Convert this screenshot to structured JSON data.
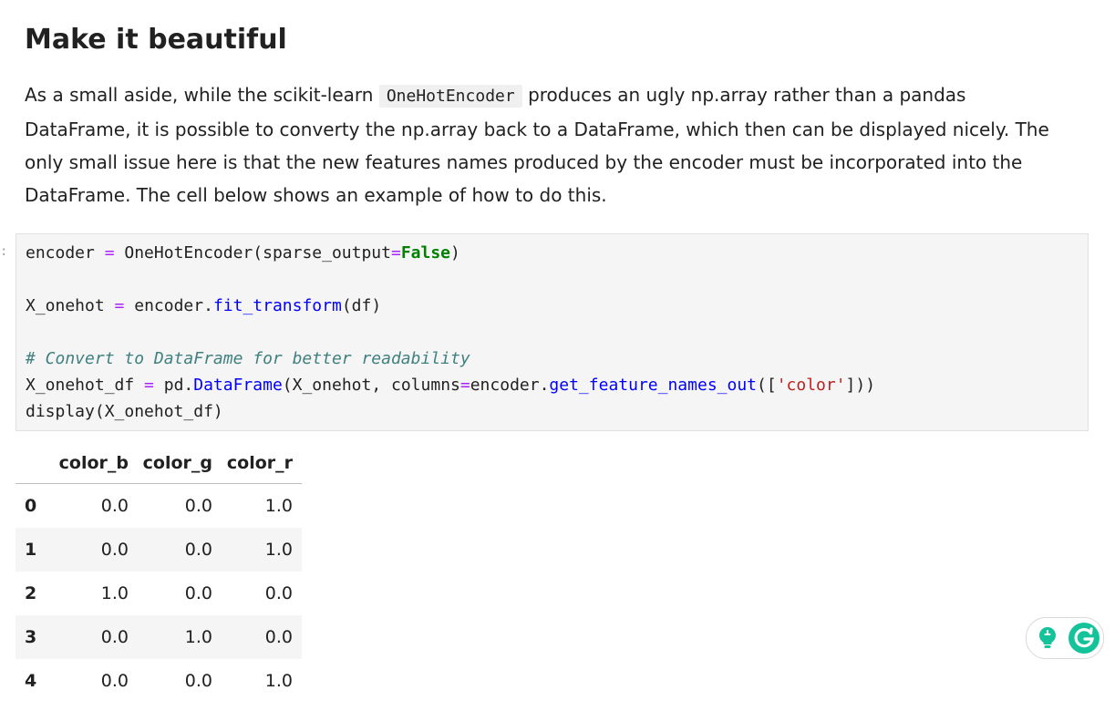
{
  "heading": "Make it beautiful",
  "paragraph": {
    "before_code": "As a small aside, while the scikit-learn ",
    "inline_code": "OneHotEncoder",
    "after_code": " produces an ugly np.array rather than a pandas DataFrame, it is possible to converty the np.array back to a DataFrame, which then can be displayed nicely. The only small issue here is that the new features names produced by the encoder must be incorporated into the DataFrame. The cell below shows an example of how to do this."
  },
  "cell_prompt": ":",
  "code": {
    "line1": {
      "a": "encoder ",
      "op": "=",
      "b": " OneHotEncoder(sparse_output",
      "op2": "=",
      "kw": "False",
      "c": ")"
    },
    "line2": {
      "a": "X_onehot ",
      "op": "=",
      "b": " encoder.",
      "fn": "fit_transform",
      "c": "(df)"
    },
    "line3": {
      "comment": "# Convert to DataFrame for better readability"
    },
    "line4": {
      "a": "X_onehot_df ",
      "op": "=",
      "b": " pd.",
      "fn": "DataFrame",
      "c": "(X_onehot, columns",
      "op2": "=",
      "d": "encoder.",
      "fn2": "get_feature_names_out",
      "e": "([",
      "str": "'color'",
      "f": "]))"
    },
    "line5": {
      "a": "display(X_onehot_df)"
    }
  },
  "colors": {
    "operator": "#aa22ff",
    "keyword": "#008000",
    "function": "#0000ff",
    "comment": "#408080",
    "string": "#ba2121",
    "grammarly_green": "#15c39a"
  },
  "grammarly": {
    "bulb_icon": "lightbulb-icon",
    "logo_icon": "grammarly-g-icon"
  },
  "table": {
    "columns": [
      "",
      "color_b",
      "color_g",
      "color_r"
    ],
    "rows": [
      {
        "index": "0",
        "values": [
          "0.0",
          "0.0",
          "1.0"
        ]
      },
      {
        "index": "1",
        "values": [
          "0.0",
          "0.0",
          "1.0"
        ]
      },
      {
        "index": "2",
        "values": [
          "1.0",
          "0.0",
          "0.0"
        ]
      },
      {
        "index": "3",
        "values": [
          "0.0",
          "1.0",
          "0.0"
        ]
      },
      {
        "index": "4",
        "values": [
          "0.0",
          "0.0",
          "1.0"
        ]
      }
    ]
  }
}
